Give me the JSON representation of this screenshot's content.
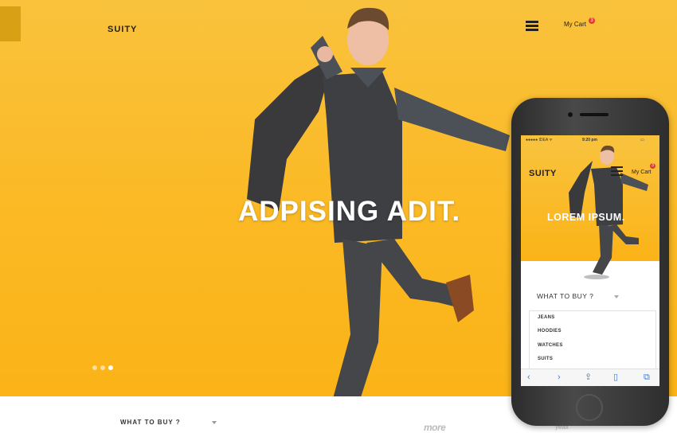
{
  "site": {
    "brand": "SUITY",
    "cart_label": "My Cart",
    "cart_count": "3",
    "hero_title": "ADPISING ADIT.",
    "carousel": {
      "count": 3,
      "active": 2
    }
  },
  "bottom_bar": {
    "what_to_buy": "WHAT TO BUY ?",
    "partner_logos": [
      "more",
      "yeax"
    ]
  },
  "phone": {
    "status": {
      "carrier": "●●●●● IDEA ᯤ",
      "time": "9:20 pm",
      "battery": "▭"
    },
    "brand": "SUITY",
    "cart_label": "My Cart",
    "cart_count": "3",
    "hero_title": "LOREM IPSUM.",
    "carousel": {
      "count": 3,
      "active": 1
    },
    "what_to_buy": "WHAT TO BUY ?",
    "menu_items": [
      "JEANS",
      "HOODIES",
      "WATCHES",
      "SUITS"
    ],
    "toolbar_icons": [
      "back-icon",
      "forward-icon",
      "share-icon",
      "bookmarks-icon",
      "tabs-icon"
    ]
  },
  "colors": {
    "accent": "#fbb924",
    "badge": "#e53a2f",
    "text_dark": "#222222",
    "toolbar_blue": "#3b7de0"
  }
}
